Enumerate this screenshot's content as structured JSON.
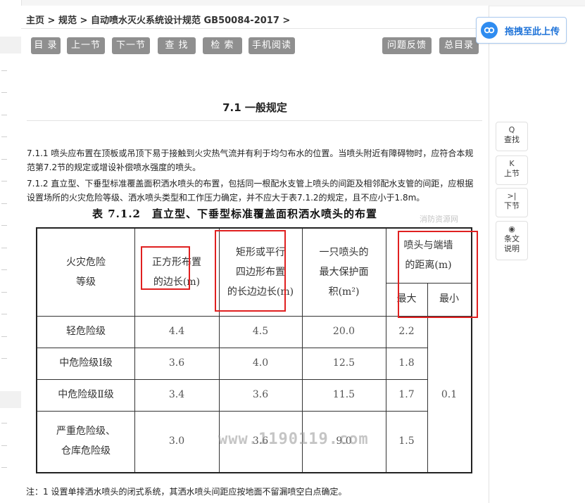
{
  "breadcrumb": [
    "主页",
    ">",
    "规范",
    ">",
    "自动喷水灭火系统设计规范 GB50084-2017",
    ">"
  ],
  "toolbar": {
    "left": [
      "目 录",
      "上一节",
      "下一节",
      "查 找",
      "检 索",
      "手机阅读"
    ],
    "right": [
      "问题反馈",
      "总目录"
    ]
  },
  "upload": {
    "label": "拖拽至此上传",
    "icon": "cloud-icon"
  },
  "side_tools": [
    {
      "icon": "search-icon",
      "glyph": "Q",
      "label": "查找"
    },
    {
      "icon": "prev-section-icon",
      "glyph": "K",
      "label": "上节"
    },
    {
      "icon": "next-section-icon",
      "glyph": ">|",
      "label": "下节"
    },
    {
      "icon": "eye-icon",
      "glyph": "◉",
      "label1": "条文",
      "label2": "说明"
    }
  ],
  "section_title": "7.1 一般规定",
  "paragraphs": [
    "7.1.1 喷头应布置在顶板或吊顶下易于接触到火灾热气流并有利于均匀布水的位置。当喷头附近有障碍物时，应符合本规范第7.2节的规定或增设补偿喷水强度的喷头。",
    "7.1.2 直立型、下垂型标准覆盖面积洒水喷头的布置，包括同一根配水支管上喷头的间距及相邻配水支管的间距，应根据设置场所的火灾危险等级、洒水喷头类型和工作压力确定，并不应大于表7.1.2的规定，且不应小于1.8m。"
  ],
  "table": {
    "caption": "表 7.1.2　直立型、下垂型标准覆盖面积洒水喷头的布置",
    "caption_watermark": "消防资源网",
    "headers": {
      "col1": [
        "火灾危险",
        "等级"
      ],
      "col2": [
        "正方形布置",
        "的边长(m)"
      ],
      "col3": [
        "矩形或平行",
        "四边形布置",
        "的长边边长(m)"
      ],
      "col4": [
        "一只喷头的",
        "最大保护面",
        "积(m²)"
      ],
      "col5": [
        "喷头与端墙",
        "的距离(m)"
      ],
      "col5a": "最大",
      "col5b": "最小"
    },
    "rows": [
      {
        "level": [
          "轻危险级"
        ],
        "square": "4.4",
        "rect": "4.5",
        "area": "20.0",
        "max": "2.2"
      },
      {
        "level": [
          "中危险级Ⅰ级"
        ],
        "square": "3.6",
        "rect": "4.0",
        "area": "12.5",
        "max": "1.8"
      },
      {
        "level": [
          "中危险级Ⅱ级"
        ],
        "square": "3.4",
        "rect": "3.6",
        "area": "11.5",
        "max": "1.7"
      },
      {
        "level": [
          "严重危险级、",
          "仓库危险级"
        ],
        "square": "3.0",
        "rect": "3.6",
        "area": "9.0",
        "max": "1.5"
      }
    ],
    "min_value": "0.1"
  },
  "watermark": "www.1190119.com",
  "note": "注：1 设置单排洒水喷头的闭式系统，其洒水喷头间距应按地面不留漏喷空白点确定。",
  "colors": {
    "button_bg": "#8f8f8f",
    "highlight": "#e02020",
    "upload_accent": "#2f8cf0"
  }
}
